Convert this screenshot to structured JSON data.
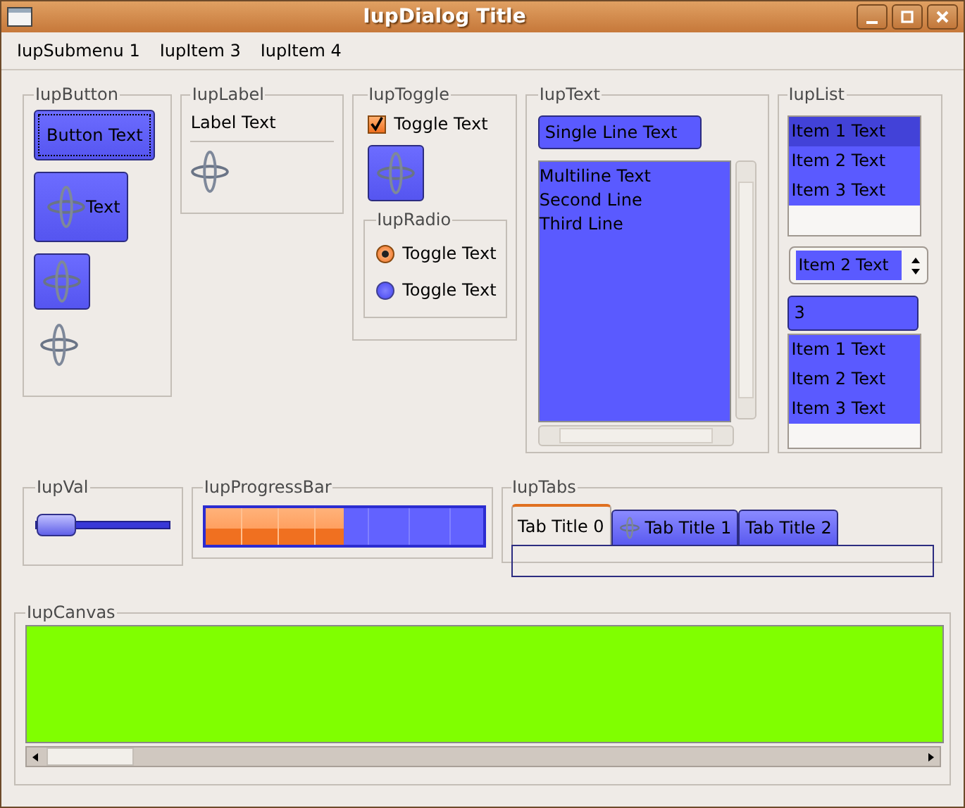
{
  "window": {
    "title": "IupDialog Title"
  },
  "menu": [
    {
      "label": "IupSubmenu 1"
    },
    {
      "label": "IupItem 3"
    },
    {
      "label": "IupItem 4"
    }
  ],
  "button_frame": {
    "title": "IupButton",
    "buttons": [
      {
        "kind": "text",
        "label": "Button Text"
      },
      {
        "kind": "icon_text",
        "label": "Text"
      },
      {
        "kind": "icon"
      },
      {
        "kind": "flat"
      }
    ]
  },
  "label_frame": {
    "title": "IupLabel",
    "text": "Label Text"
  },
  "toggle_frame": {
    "title": "IupToggle",
    "check": {
      "label": "Toggle Text",
      "checked": true
    }
  },
  "radio_frame": {
    "title": "IupRadio",
    "options": [
      {
        "label": "Toggle Text",
        "selected": true
      },
      {
        "label": "Toggle Text",
        "selected": false
      }
    ]
  },
  "text_frame": {
    "title": "IupText",
    "single_line": "Single Line Text",
    "multiline": [
      "Multiline Text",
      "Second Line",
      "Third Line"
    ]
  },
  "list_frame": {
    "title": "IupList",
    "list": [
      {
        "label": "Item 1 Text",
        "selected": true
      },
      {
        "label": "Item 2 Text",
        "selected": false
      },
      {
        "label": "Item 3 Text",
        "selected": false
      }
    ],
    "dropdown": {
      "value": "Item 2 Text"
    },
    "edit_value": "3",
    "edit_list": [
      {
        "label": "Item 1 Text",
        "selected": false
      },
      {
        "label": "Item 2 Text",
        "selected": false
      },
      {
        "label": "Item 3 Text",
        "selected": false
      }
    ]
  },
  "val_frame": {
    "title": "IupVal",
    "level": 0
  },
  "progress_frame": {
    "title": "IupProgressBar",
    "level": 0.5
  },
  "tabs_frame": {
    "title": "IupTabs",
    "tabs": [
      {
        "label": "Tab Title 0",
        "selected": true,
        "icon": false
      },
      {
        "label": "Tab Title 1",
        "selected": false,
        "icon": true
      },
      {
        "label": "Tab Title 2",
        "selected": false,
        "icon": false
      }
    ]
  },
  "canvas_frame": {
    "title": "IupCanvas"
  }
}
